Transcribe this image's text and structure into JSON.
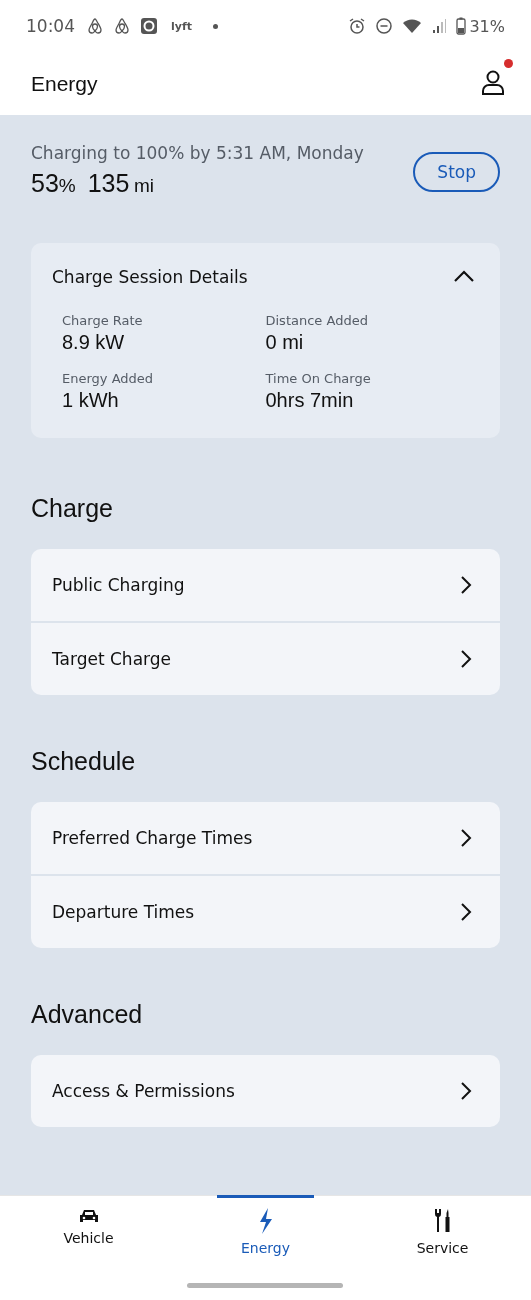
{
  "status_bar": {
    "time": "10:04",
    "app_label": "lyft",
    "battery": "31%"
  },
  "header": {
    "title": "Energy",
    "notification_dot": true
  },
  "charging": {
    "status": "Charging to 100% by 5:31 AM, Monday",
    "percent": "53",
    "percent_unit": "%",
    "range": "135",
    "range_unit": "mi",
    "stop_button": "Stop"
  },
  "session": {
    "title": "Charge Session Details",
    "expanded": true,
    "stats": [
      {
        "label": "Charge Rate",
        "value": "8.9 kW"
      },
      {
        "label": "Distance Added",
        "value": "0 mi"
      },
      {
        "label": "Energy Added",
        "value": "1 kWh"
      },
      {
        "label": "Time On Charge",
        "value": "0hrs 7min"
      }
    ]
  },
  "sections": [
    {
      "title": "Charge",
      "items": [
        "Public Charging",
        "Target Charge"
      ]
    },
    {
      "title": "Schedule",
      "items": [
        "Preferred Charge Times",
        "Departure Times"
      ]
    },
    {
      "title": "Advanced",
      "items": [
        "Access & Permissions"
      ]
    }
  ],
  "bottom_nav": [
    {
      "label": "Vehicle",
      "kind": "car",
      "selected": false
    },
    {
      "label": "Energy",
      "kind": "bolt",
      "selected": true
    },
    {
      "label": "Service",
      "kind": "tools",
      "selected": false
    }
  ]
}
